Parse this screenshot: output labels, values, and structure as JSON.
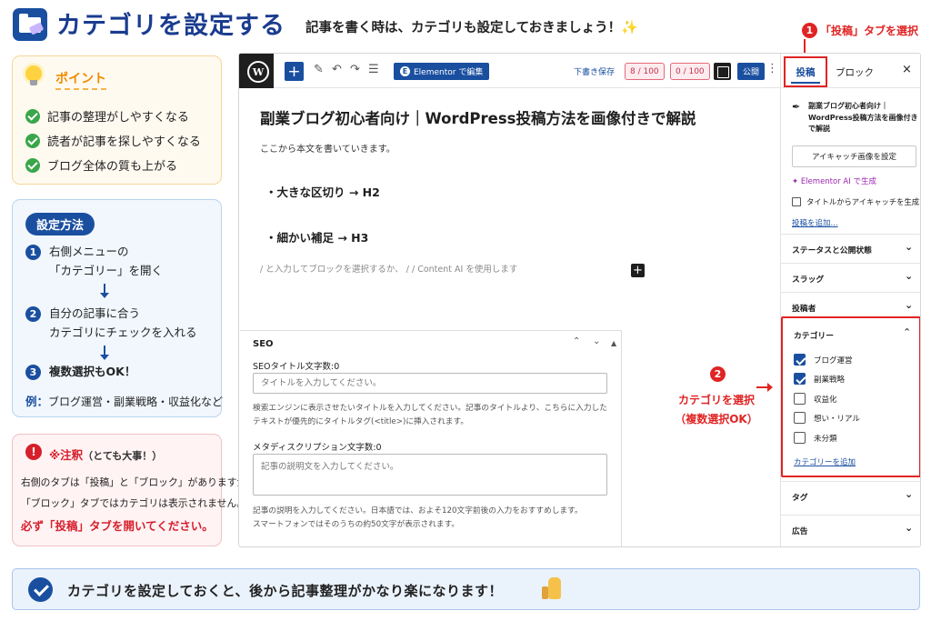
{
  "header": {
    "title": "カテゴリを設定する",
    "subtitle": "記事を書く時は、カテゴリも設定しておきましょう！",
    "sparkle": "✨",
    "annotation1_num": "1",
    "annotation1_text": "「投稿」タブを選択"
  },
  "point_card": {
    "title": "ポイント",
    "items": [
      "記事の整理がしやすくなる",
      "読者が記事を探しやすくなる",
      "ブログ全体の質も上がる"
    ]
  },
  "method_card": {
    "title": "設定方法",
    "steps": [
      {
        "num": "1",
        "line1": "右側メニューの",
        "line2": "「カテゴリー」を開く"
      },
      {
        "num": "2",
        "line1": "自分の記事に合う",
        "line2": "カテゴリにチェックを入れる"
      },
      {
        "num": "3",
        "line1": "複数選択もOK！",
        "line2": ""
      }
    ],
    "example_label": "例：",
    "example_text": "ブログ運営・副業戦略・収益化など"
  },
  "note_card": {
    "icon": "!",
    "title": "※注釈",
    "title_sub": "（とても大事！）",
    "line1": "右側のタブは「投稿」と「ブロック」がありますが、",
    "line2": "「ブロック」タブではカテゴリは表示されません。",
    "strong": "必ず「投稿」タブを開いてください。"
  },
  "toolbar": {
    "elementor_label": "Elementor で編集",
    "elementor_icon": "E",
    "draft_label": "下書き保存",
    "score1": "8 / 100",
    "score2": "0 / 100",
    "publish_label": "公開",
    "more": "⋮"
  },
  "editor": {
    "post_title": "副業ブログ初心者向け｜WordPress投稿方法を画像付きで解説",
    "body_text": "ここから本文を書いていきます。",
    "heading1": "・大きな区切り → H2",
    "heading2": "・細かい補足 → H3",
    "placeholder": "/ と入力してブロックを選択するか、 / / Content AI を使用します"
  },
  "seo": {
    "title": "SEO",
    "title_label": "SEOタイトル文字数:0",
    "title_placeholder": "タイトルを入力してください。",
    "title_help1": "検索エンジンに表示させたいタイトルを入力してください。記事のタイトルより、こちらに入力した",
    "title_help2": "テキストが優先的にタイトルタグ(<title>)に挿入されます。",
    "desc_label": "メタディスクリプション文字数:0",
    "desc_placeholder": "記事の説明文を入力してください。",
    "desc_help1": "記事の説明を入力してください。日本語では、およそ120文字前後の入力をおすすめします。",
    "desc_help2": "スマートフォンではそのうちの約50文字が表示されます。"
  },
  "sidebar": {
    "tab_post": "投稿",
    "tab_block": "ブロック",
    "close": "×",
    "post_name": "副業ブログ初心者向け｜WordPress投稿方法を画像付きで解説",
    "featured_button": "アイキャッチ画像を設定",
    "elementor_ai": "Elementor AI で生成",
    "generate_checkbox": "タイトルからアイキャッチを生成する",
    "add_post_link": "投稿を追加...",
    "sections": [
      "ステータスと公開状態",
      "スラッグ",
      "投稿者"
    ],
    "category_title": "カテゴリー",
    "categories": [
      {
        "label": "ブログ運営",
        "checked": true
      },
      {
        "label": "副業戦略",
        "checked": true
      },
      {
        "label": "収益化",
        "checked": false
      },
      {
        "label": "想い・リアル",
        "checked": false
      },
      {
        "label": "未分類",
        "checked": false
      }
    ],
    "add_category": "カテゴリーを追加",
    "bottom_sections": [
      "タグ",
      "広告"
    ]
  },
  "annotation2": {
    "num": "2",
    "line1": "カテゴリを選択",
    "line2": "（複数選択OK）"
  },
  "footer": {
    "text": "カテゴリを設定しておくと、後から記事整理がかなり楽になります！"
  }
}
